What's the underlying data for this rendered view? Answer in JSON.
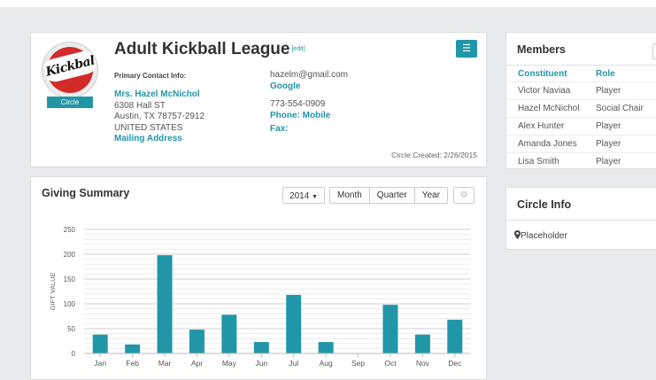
{
  "header": {
    "title": "Adult Kickball League",
    "edit_label": "[edit]",
    "logo_text": "Kickbal",
    "logo_badge": "Circle",
    "menu_icon": "hamburger-icon"
  },
  "contact": {
    "label": "Primary Contact Info:",
    "name": "Mrs. Hazel McNichol",
    "address_line1": "6308 Hall ST",
    "address_line2": "Austin, TX 78757-2912",
    "country": "UNITED STATES",
    "address_type": "Mailing Address",
    "email": "hazelm@gmail.com",
    "email_type": "Google",
    "phone": "773-554-0909",
    "phone_type": "Phone: Mobile",
    "fax_label": "Fax:",
    "created": "Circle Created: 2/26/2015"
  },
  "members": {
    "title": "Members",
    "col_constituent": "Constituent",
    "col_role": "Role",
    "rows": [
      {
        "name": "Victor Naviaa",
        "role": "Player"
      },
      {
        "name": "Hazel McNichol",
        "role": "Social Chair"
      },
      {
        "name": "Alex Hunter",
        "role": "Player"
      },
      {
        "name": "Amanda Jones",
        "role": "Player"
      },
      {
        "name": "Lisa Smith",
        "role": "Player"
      }
    ]
  },
  "circle_info": {
    "title": "Circle Info",
    "placeholder": "Placeholder",
    "pin_icon": "map-marker-icon"
  },
  "giving": {
    "title": "Giving Summary",
    "year_label": "2014",
    "periods": [
      "Month",
      "Quarter",
      "Year"
    ],
    "gear_icon": "gear-icon"
  },
  "colors": {
    "accent": "#2196a9",
    "bar": "#2196a9",
    "logo_red": "#d32a2a"
  },
  "chart_data": {
    "type": "bar",
    "categories": [
      "Jan",
      "Feb",
      "Mar",
      "Apr",
      "May",
      "Jun",
      "Jul",
      "Aug",
      "Sep",
      "Oct",
      "Nov",
      "Dec"
    ],
    "values": [
      38,
      18,
      198,
      48,
      78,
      23,
      118,
      23,
      0,
      98,
      38,
      68
    ],
    "ylabel": "GIFT VALUE",
    "ylim": [
      0,
      250
    ],
    "yticks": [
      0,
      50,
      100,
      150,
      200,
      250
    ],
    "grid": true
  }
}
